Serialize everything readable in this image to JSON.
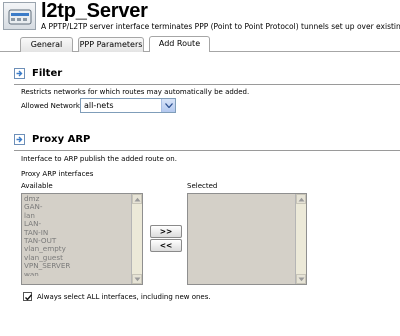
{
  "header": {
    "title": "l2tp_Server",
    "description": "A PPTP/L2TP server interface terminates PPP (Point to Point Protocol) tunnels set up over existing IP networks."
  },
  "tabs": [
    {
      "label": "General",
      "active": false
    },
    {
      "label": "PPP Parameters",
      "active": false
    },
    {
      "label": "Add Route",
      "active": true
    }
  ],
  "filter": {
    "heading": "Filter",
    "description": "Restricts networks for which routes may automatically be added.",
    "allowed_networks_label": "Allowed Networks:",
    "allowed_networks_value": "all-nets"
  },
  "proxy_arp": {
    "heading": "Proxy ARP",
    "description": "Interface to ARP publish the added route on.",
    "interfaces_label": "Proxy ARP interfaces",
    "available_label": "Available",
    "selected_label": "Selected",
    "available": [
      "dmz",
      "GAN-",
      "lan",
      "LAN-",
      "TAN-IN",
      "TAN-OUT",
      "vlan_empty",
      "vlan_guest",
      "VPN_SERVER",
      "wan"
    ],
    "selected": [],
    "add_button": ">>",
    "remove_button": "<<",
    "always_select_all_label": "Always select ALL interfaces, including new ones.",
    "always_select_all_checked": true
  },
  "colors": {
    "accent": "#3a7bc8",
    "disabled_list_bg": "#d4d0c8",
    "rule": "#9a9a9a"
  }
}
